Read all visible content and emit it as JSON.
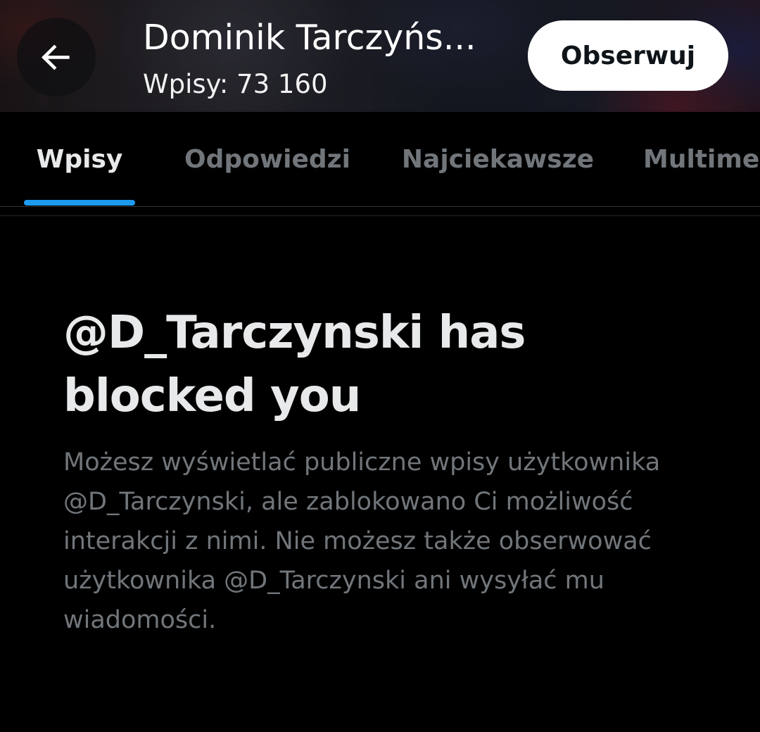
{
  "header": {
    "back_icon": "arrow-left-icon",
    "profile_name": "Dominik Tarczyńs...",
    "post_count": "Wpisy: 73 160",
    "follow_label": "Obserwuj"
  },
  "tabs": [
    {
      "label": "Wpisy",
      "active": true
    },
    {
      "label": "Odpowiedzi",
      "active": false
    },
    {
      "label": "Najciekawsze",
      "active": false
    },
    {
      "label": "Multime",
      "active": false
    }
  ],
  "blocked": {
    "title": "@D_Tarczynski has blocked you",
    "description": "Możesz wyświetlać publiczne wpisy użytkownika @D_Tarczynski, ale zablokowano Ci możliwość interakcji z nimi. Nie możesz także obserwować użytkownika @D_Tarczynski ani wysyłać mu wiadomości."
  },
  "colors": {
    "accent": "#1d9bf0",
    "background": "#000000",
    "text_primary": "#e7e9ea",
    "text_secondary": "#71767b"
  }
}
